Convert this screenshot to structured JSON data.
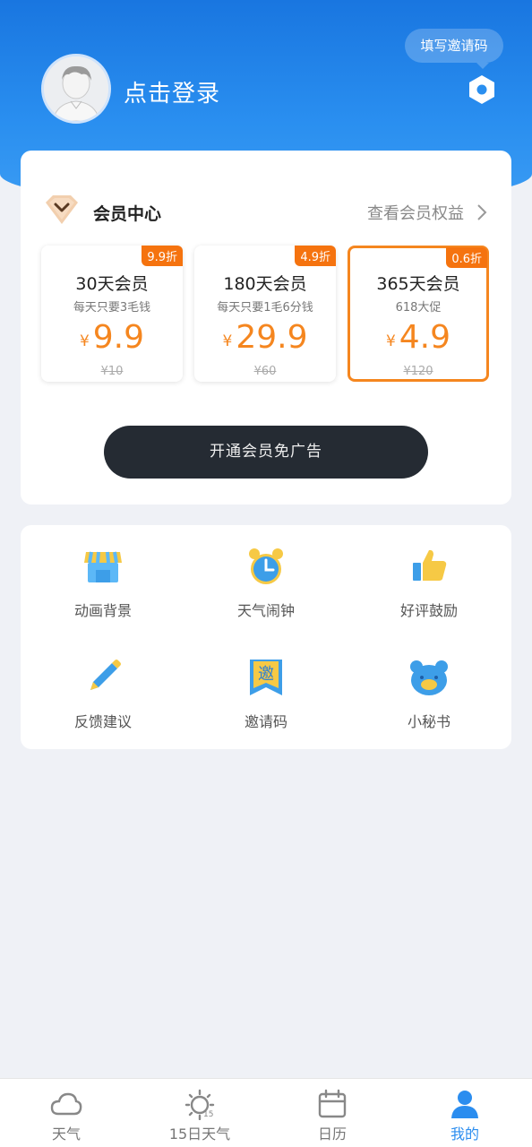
{
  "header": {
    "login_text": "点击登录",
    "invite_bubble": "填写邀请码"
  },
  "member": {
    "title": "会员中心",
    "benefits_link": "查看会员权益",
    "plans": [
      {
        "badge": "9.9折",
        "name": "30天会员",
        "desc": "每天只要3毛钱",
        "currency": "¥",
        "price": "9.9",
        "original": "¥10",
        "selected": false
      },
      {
        "badge": "4.9折",
        "name": "180天会员",
        "desc": "每天只要1毛6分钱",
        "currency": "¥",
        "price": "29.9",
        "original": "¥60",
        "selected": false
      },
      {
        "badge": "0.6折",
        "name": "365天会员",
        "desc": "618大促",
        "currency": "¥",
        "price": "4.9",
        "original": "¥120",
        "selected": true
      }
    ],
    "open_button": "开通会员免广告"
  },
  "tools": [
    {
      "label": "动画背景",
      "icon": "store-icon"
    },
    {
      "label": "天气闹钟",
      "icon": "alarm-clock-icon"
    },
    {
      "label": "好评鼓励",
      "icon": "thumbs-up-icon"
    },
    {
      "label": "反馈建议",
      "icon": "pencil-icon"
    },
    {
      "label": "邀请码",
      "icon": "invite-bookmark-icon",
      "glyph": "邀"
    },
    {
      "label": "小秘书",
      "icon": "bear-icon"
    }
  ],
  "tabbar": [
    {
      "label": "天气",
      "icon": "cloud-icon",
      "active": false
    },
    {
      "label": "15日天气",
      "icon": "sun-15-icon",
      "glyph": "15",
      "active": false
    },
    {
      "label": "日历",
      "icon": "calendar-icon",
      "active": false
    },
    {
      "label": "我的",
      "icon": "person-icon",
      "active": true
    }
  ],
  "colors": {
    "header_blue": "#1976e0",
    "accent_orange": "#f5861f",
    "badge_orange": "#f5730f",
    "button_dark": "#252b33",
    "tab_active": "#2b8def"
  }
}
